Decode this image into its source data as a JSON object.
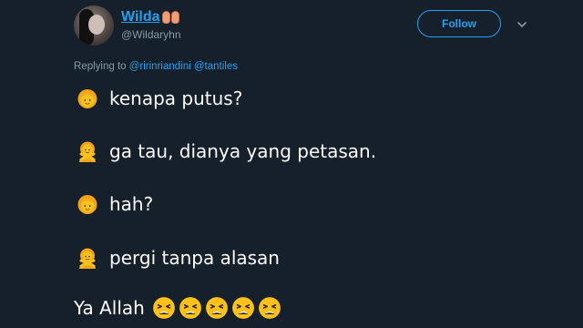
{
  "user": {
    "display_name": "Wilda",
    "handle": "@Wildaryhn"
  },
  "follow_label": "Follow",
  "reply": {
    "prefix": "Replying to ",
    "mention1": "@ririnriandini",
    "mention2": "@tantiles"
  },
  "lines": [
    {
      "text": "kenapa putus?",
      "emoji": "woman-emoji"
    },
    {
      "text": "ga tau, dianya yang petasan.",
      "emoji": "person-gesturing-no-emoji"
    },
    {
      "text": "hah?",
      "emoji": "woman-emoji"
    },
    {
      "text": "pergi tanpa alasan",
      "emoji": "person-gesturing-no-emoji"
    }
  ],
  "closing": {
    "text": "Ya Allah",
    "emoji": "tired-face-emoji",
    "emoji_count": 5
  },
  "colors": {
    "background": "#15202b",
    "accent": "#1da1f2",
    "secondary_text": "#8899a6",
    "emoji_skin": "#fcc21b",
    "emoji_hair": "#f5a21d"
  }
}
